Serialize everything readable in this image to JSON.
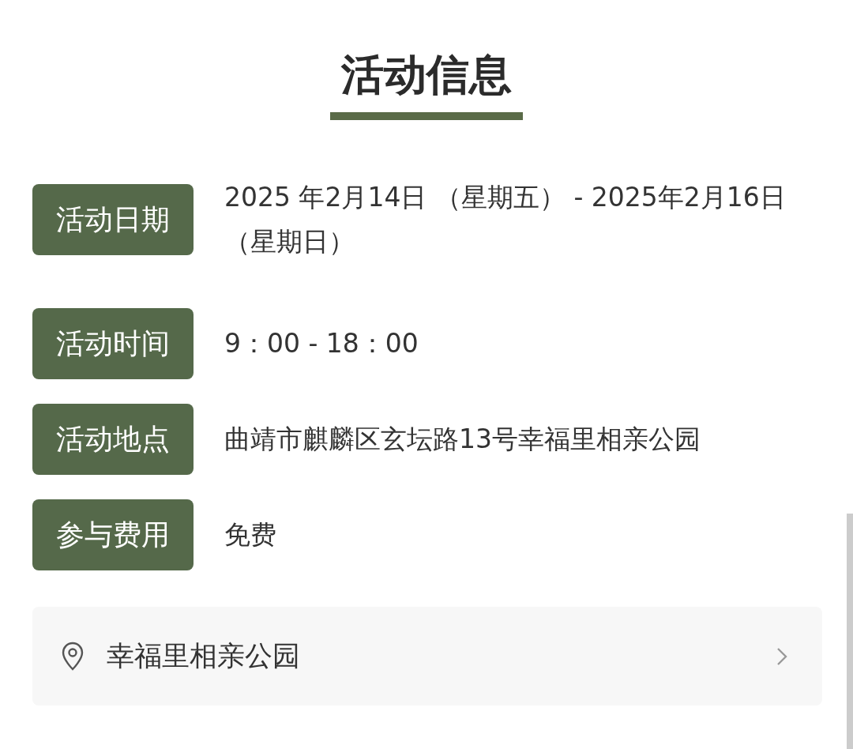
{
  "title": "活动信息",
  "rows": [
    {
      "label": "活动日期",
      "value": "2025 年2月14日 （星期五） - 2025年2月16日（星期日）"
    },
    {
      "label": "活动时间",
      "value": "9：00 - 18：00"
    },
    {
      "label": "活动地点",
      "value": "曲靖市麒麟区玄坛路13号幸福里相亲公园"
    },
    {
      "label": "参与费用",
      "value": "免费"
    }
  ],
  "location": {
    "name": "幸福里相亲公园"
  }
}
